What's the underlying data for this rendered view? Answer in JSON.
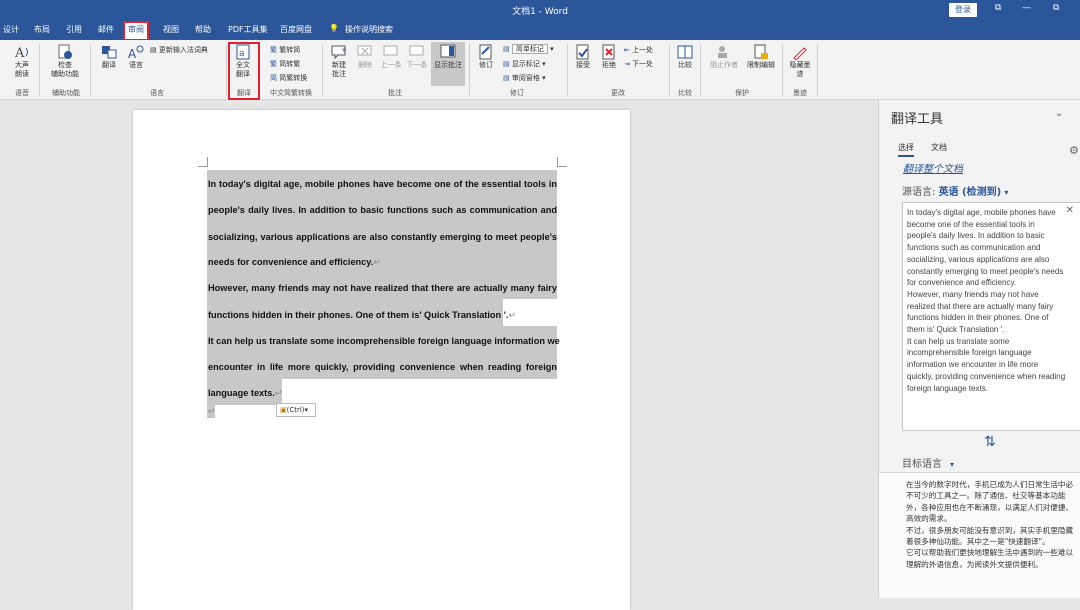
{
  "window": {
    "title": "文档1 - Word",
    "login": "登录",
    "ribbon_display_icon": "⧉",
    "minimize_icon": "—",
    "restore_icon": "⧉"
  },
  "tabs": [
    "设计",
    "布局",
    "引用",
    "邮件",
    "审阅",
    "视图",
    "帮助",
    "PDF工具集",
    "百度网盘",
    "操作说明搜索"
  ],
  "active_tab": "审阅",
  "ribbon": {
    "read_aloud": "大声\n朗读",
    "check_accessibility": "检查\n辅助功能",
    "translate": "翻译",
    "language": "语言",
    "update_ime": "更新输入法词典",
    "full_translate": "全文\n翻译",
    "to_traditional": "繁转简",
    "to_simplified": "简转繁",
    "conversion": "简繁转换",
    "new_comment": "新建\n批注",
    "delete": "删除",
    "previous": "上一条",
    "next": "下一条",
    "show_comments": "显示批注",
    "track_changes": "修订",
    "simple_markup": "简单标记",
    "show_markup": "显示标记",
    "review_pane": "审阅窗格",
    "accept": "接受",
    "reject": "拒绝",
    "prev_change": "上一处",
    "next_change": "下一处",
    "compare": "比较",
    "block_authors": "阻止作者",
    "restrict_editing": "限制编辑",
    "hide_ink": "隐藏墨\n迹",
    "groups": {
      "speech": "语音",
      "accessibility": "辅助功能",
      "language": "语言",
      "translate": "翻译",
      "chinese_conversion": "中文简繁转换",
      "comments": "批注",
      "tracking": "修订",
      "changes": "更改",
      "compare": "比较",
      "protect": "保护",
      "ink": "墨迹"
    }
  },
  "document": {
    "lines": [
      "In today's digital age, mobile phones have become one of the essential tools in",
      "people's daily lives. In addition to basic functions such as communication and",
      "socializing, various applications are also constantly emerging to meet people's",
      "needs for convenience and efficiency.",
      "However, many friends may not have realized that there are actually many fairy",
      "functions hidden in their phones. One of them is' Quick Translation '.",
      "It can help us translate some incomprehensible foreign language information we",
      "encounter in life more quickly, providing convenience when reading foreign",
      "language texts."
    ],
    "paragraph_mark": "↵",
    "paste_options": "(Ctrl)"
  },
  "pane": {
    "title": "翻译工具",
    "tab_selection": "选择",
    "tab_document": "文档",
    "translate_whole": "翻译整个文档",
    "source_label": "源语言:",
    "source_value": "英语 (检测到)",
    "source_text": "In today's digital age, mobile phones have become one of the essential tools in people's daily lives. In addition to basic functions such as communication and socializing, various applications are also constantly emerging to meet people's needs for convenience and efficiency.\nHowever, many friends may not have realized that there are actually many fairy functions hidden in their phones. One of them is' Quick Translation '.\nIt can help us translate some incomprehensible foreign language information we encounter in life more quickly, providing convenience when reading foreign language texts.",
    "target_label": "目标语言",
    "target_text": "在当今的数字时代，手机已成为人们日常生活中必不可少的工具之一。除了通信、社交等基本功能外，各种应用也在不断涌现，以满足人们对便捷、高效的需求。\n不过，很多朋友可能没有意识到，其实手机里隐藏着很多神仙功能。其中之一是\"快速翻译\"。\n它可以帮助我们更快地理解生活中遇到的一些难以理解的外语信息，为阅读外文提供便利。"
  }
}
